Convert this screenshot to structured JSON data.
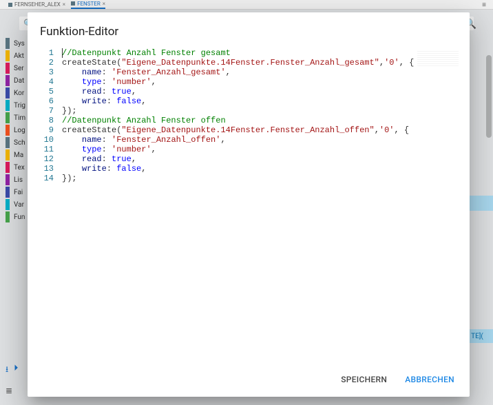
{
  "bg": {
    "tabs": [
      {
        "label": "FERNSEHER_ALEX",
        "active": false
      },
      {
        "label": "FENSTER",
        "active": true
      }
    ],
    "sidebar": [
      "Sys",
      "Akt",
      "Ser",
      "Dat",
      "Kor",
      "Trig",
      "Tim",
      "Log",
      "Sch",
      "Ma",
      "Tex",
      "Lis",
      "Fai",
      "Var",
      "Fun"
    ],
    "right_badge": "TE](",
    "bottom_icons": [
      "download",
      "start"
    ]
  },
  "modal": {
    "title": "Funktion-Editor",
    "save_label": "SPEICHERN",
    "cancel_label": "ABBRECHEN"
  },
  "code": {
    "lines": [
      {
        "n": 1,
        "indent": 0,
        "t": [
          [
            "comment",
            "//Datenpunkt Anzahl Fenster gesamt"
          ]
        ]
      },
      {
        "n": 2,
        "indent": 0,
        "t": [
          [
            "fn",
            "createState("
          ],
          [
            "string",
            "\"Eigene_Datenpunkte.14Fenster.Fenster_Anzahl_gesamt\""
          ],
          [
            "fn",
            ","
          ],
          [
            "string",
            "'0'"
          ],
          [
            "fn",
            ", {"
          ]
        ]
      },
      {
        "n": 3,
        "indent": 2,
        "t": [
          [
            "propname",
            "name"
          ],
          [
            "colon",
            ": "
          ],
          [
            "string",
            "'Fenster_Anzahl_gesamt'"
          ],
          [
            "fn",
            ","
          ]
        ]
      },
      {
        "n": 4,
        "indent": 2,
        "t": [
          [
            "type",
            "type"
          ],
          [
            "colon",
            ": "
          ],
          [
            "string",
            "'number'"
          ],
          [
            "fn",
            ","
          ]
        ]
      },
      {
        "n": 5,
        "indent": 2,
        "t": [
          [
            "propname",
            "read"
          ],
          [
            "colon",
            ": "
          ],
          [
            "bool",
            "true"
          ],
          [
            "fn",
            ","
          ]
        ]
      },
      {
        "n": 6,
        "indent": 2,
        "t": [
          [
            "propname",
            "write"
          ],
          [
            "colon",
            ": "
          ],
          [
            "bool",
            "false"
          ],
          [
            "fn",
            ","
          ]
        ]
      },
      {
        "n": 7,
        "indent": 0,
        "t": [
          [
            "fn",
            "});"
          ]
        ]
      },
      {
        "n": 8,
        "indent": 0,
        "t": [
          [
            "comment",
            "//Datenpunkt Anzahl Fenster offen"
          ]
        ]
      },
      {
        "n": 9,
        "indent": 0,
        "t": [
          [
            "fn",
            "createState("
          ],
          [
            "string",
            "\"Eigene_Datenpunkte.14Fenster.Fenster_Anzahl_offen\""
          ],
          [
            "fn",
            ","
          ],
          [
            "string",
            "'0'"
          ],
          [
            "fn",
            ", {"
          ]
        ]
      },
      {
        "n": 10,
        "indent": 2,
        "t": [
          [
            "propname",
            "name"
          ],
          [
            "colon",
            ": "
          ],
          [
            "string",
            "'Fenster_Anzahl_offen'"
          ],
          [
            "fn",
            ","
          ]
        ]
      },
      {
        "n": 11,
        "indent": 2,
        "t": [
          [
            "type",
            "type"
          ],
          [
            "colon",
            ": "
          ],
          [
            "string",
            "'number'"
          ],
          [
            "fn",
            ","
          ]
        ]
      },
      {
        "n": 12,
        "indent": 2,
        "t": [
          [
            "propname",
            "read"
          ],
          [
            "colon",
            ": "
          ],
          [
            "bool",
            "true"
          ],
          [
            "fn",
            ","
          ]
        ]
      },
      {
        "n": 13,
        "indent": 2,
        "t": [
          [
            "propname",
            "write"
          ],
          [
            "colon",
            ": "
          ],
          [
            "bool",
            "false"
          ],
          [
            "fn",
            ","
          ]
        ]
      },
      {
        "n": 14,
        "indent": 0,
        "t": [
          [
            "fn",
            "});"
          ]
        ]
      }
    ]
  }
}
